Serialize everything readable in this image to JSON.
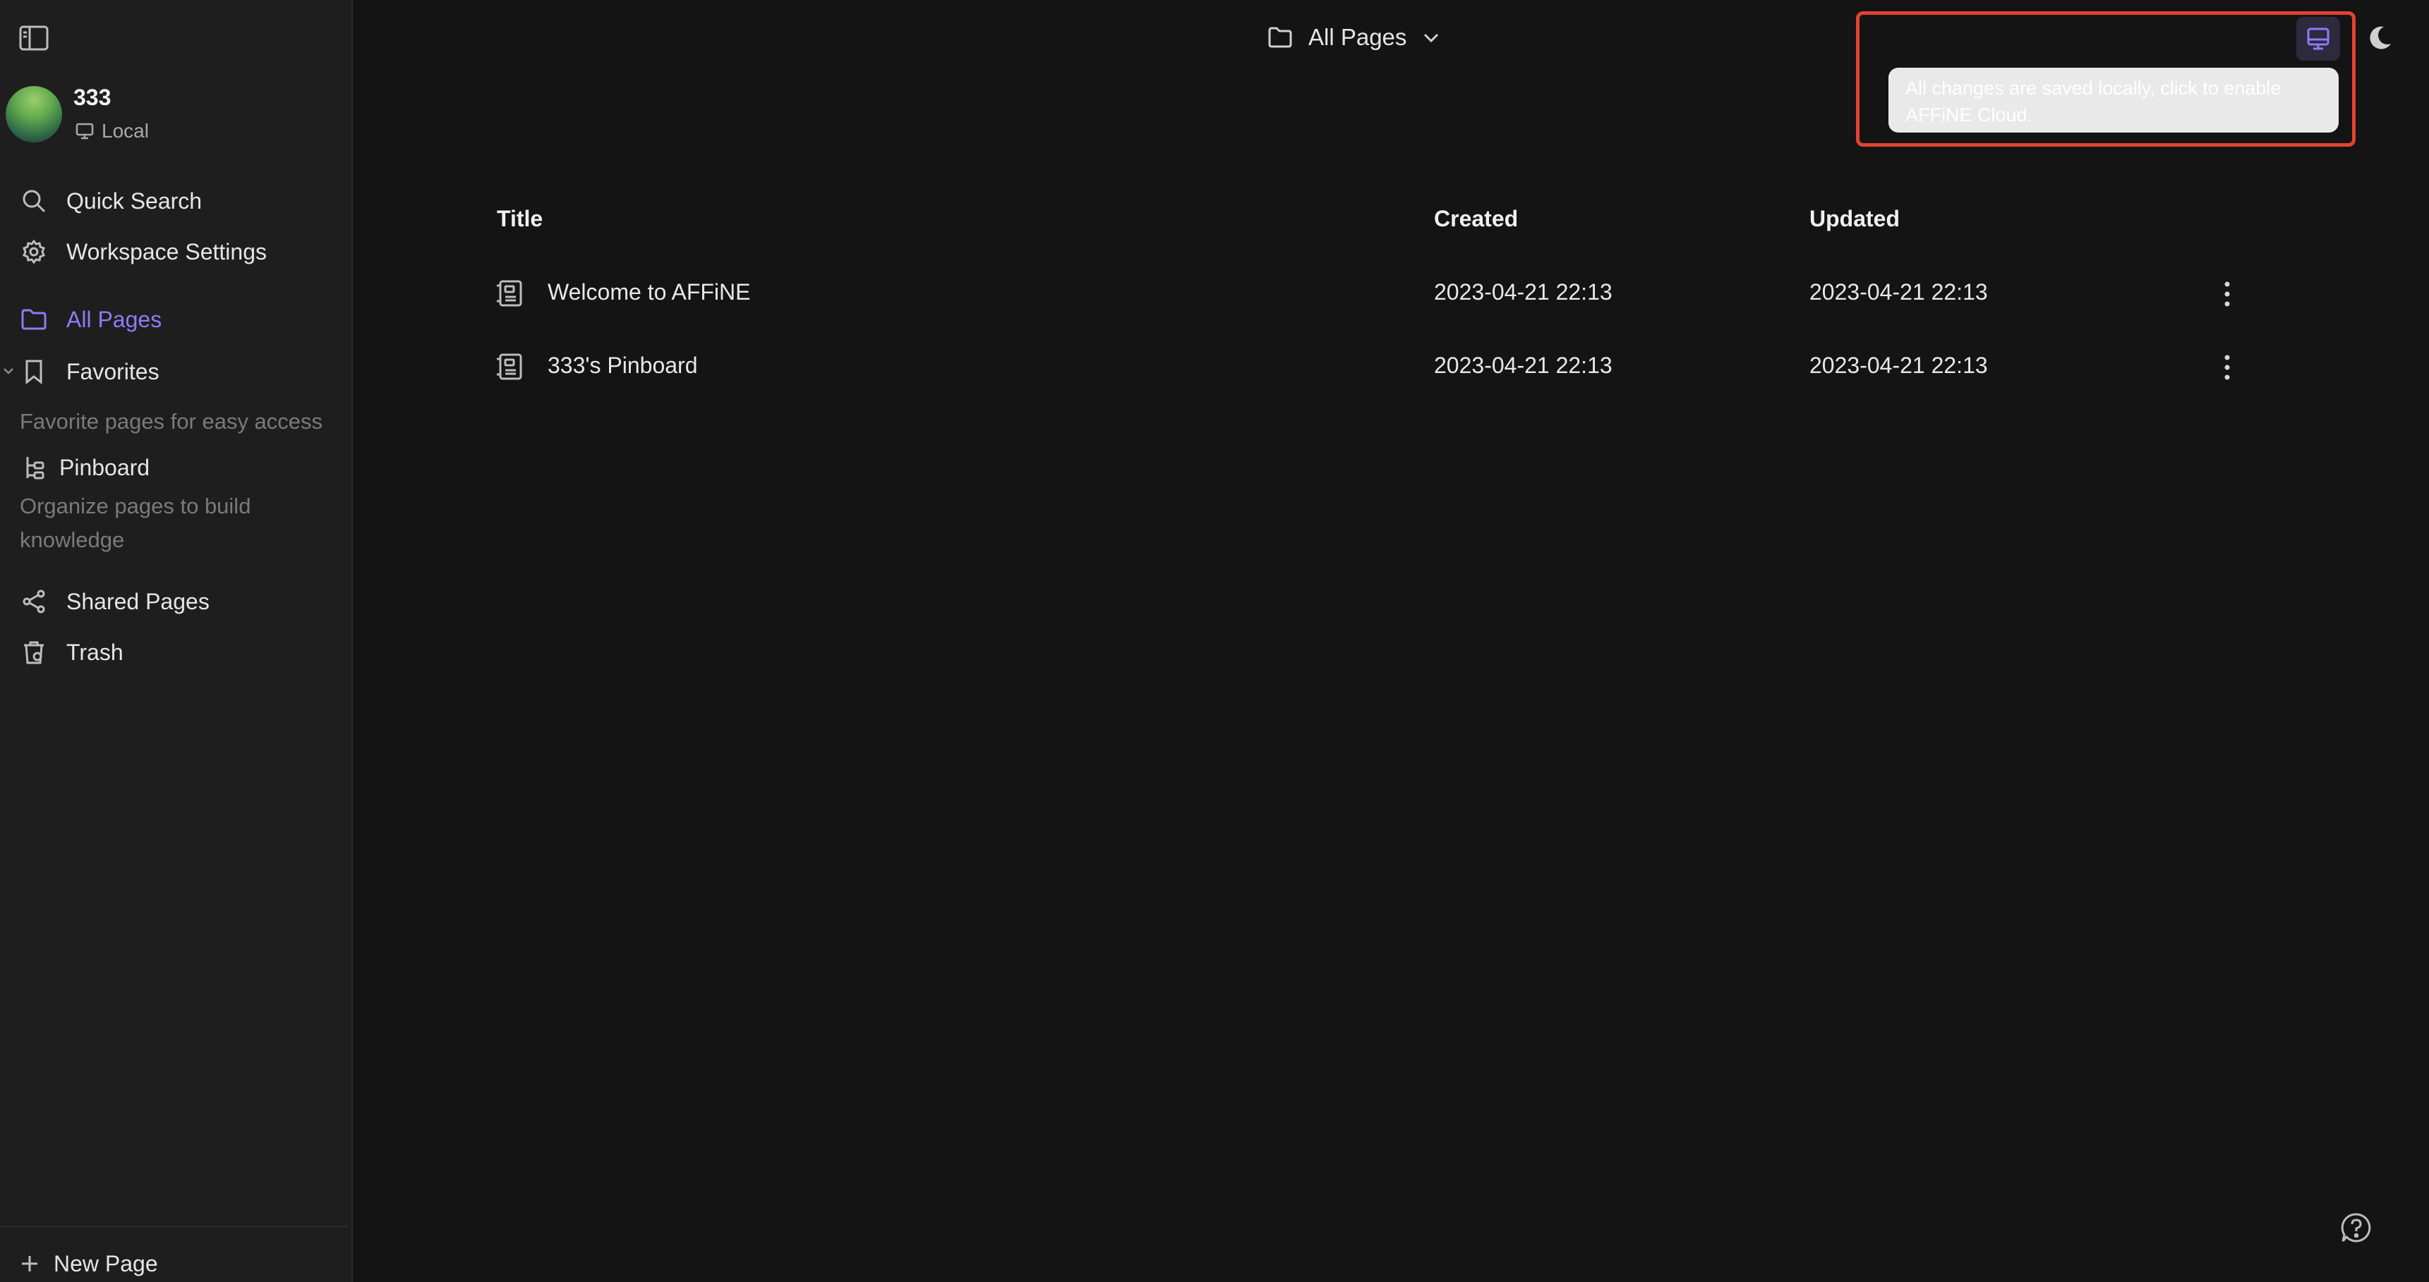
{
  "workspace": {
    "name": "333",
    "status": "Local"
  },
  "sidebar": {
    "quick_search": "Quick Search",
    "workspace_settings": "Workspace Settings",
    "all_pages": "All Pages",
    "favorites": "Favorites",
    "favorites_hint": "Favorite pages for easy access",
    "pinboard": "Pinboard",
    "pinboard_hint": "Organize pages to build knowledge",
    "shared_pages": "Shared Pages",
    "trash": "Trash",
    "new_page": "New Page"
  },
  "header": {
    "title": "All Pages"
  },
  "table": {
    "columns": {
      "title": "Title",
      "created": "Created",
      "updated": "Updated"
    },
    "rows": [
      {
        "title": "Welcome to AFFiNE",
        "created": "2023-04-21 22:13",
        "updated": "2023-04-21 22:13"
      },
      {
        "title": "333's Pinboard",
        "created": "2023-04-21 22:13",
        "updated": "2023-04-21 22:13"
      }
    ]
  },
  "tooltip": {
    "text": "All changes are saved locally, click to enable AFFiNE Cloud."
  },
  "colors": {
    "accent": "#8d7cf6",
    "highlight": "#e2432f",
    "background": "#141414",
    "sidebar": "#1e1e1e"
  },
  "icons": {
    "sidebar_toggle": "sidebar-toggle-icon",
    "local": "computer-icon",
    "search": "search-icon",
    "settings": "gear-icon",
    "folder": "folder-icon",
    "favorite": "bookmark-icon",
    "pinboard": "pinboard-icon",
    "share": "share-icon",
    "trash": "trash-icon",
    "add": "plus-icon",
    "page": "page-icon",
    "more": "more-vertical-icon",
    "theme": "moon-icon",
    "help": "help-icon"
  }
}
